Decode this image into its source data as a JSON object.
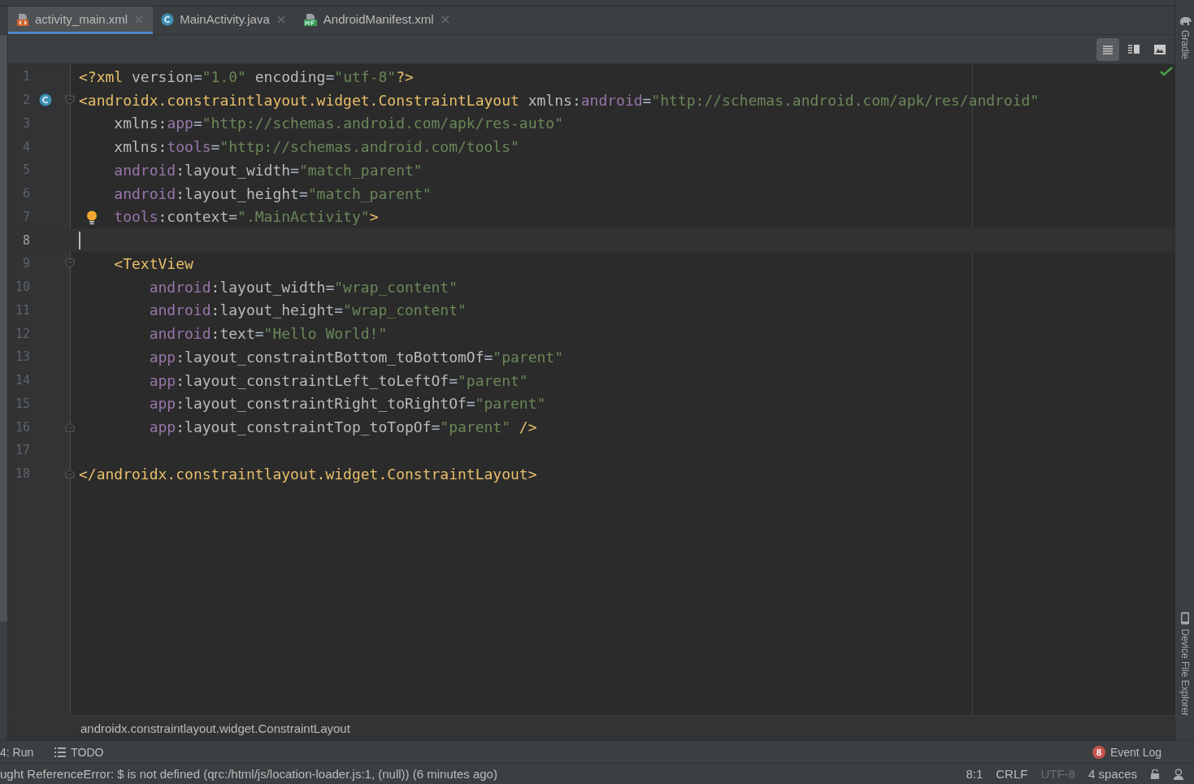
{
  "tabs": [
    {
      "label": "activity_main.xml",
      "kind": "xml",
      "selected": true
    },
    {
      "label": "MainActivity.java",
      "kind": "class",
      "selected": false
    },
    {
      "label": "AndroidManifest.xml",
      "kind": "manifest",
      "selected": false
    }
  ],
  "view_modes": [
    {
      "kind": "code",
      "selected": true
    },
    {
      "kind": "split",
      "selected": false
    },
    {
      "kind": "design",
      "selected": false
    }
  ],
  "editor": {
    "lines": [
      {
        "number": "1",
        "current": false,
        "tokens": [
          {
            "kind": "tag",
            "text": "<?xml"
          },
          {
            "kind": "attr",
            "text": " version"
          },
          {
            "kind": "plain",
            "text": "="
          },
          {
            "kind": "value",
            "text": "\"1.0\""
          },
          {
            "kind": "attr",
            "text": " encoding"
          },
          {
            "kind": "plain",
            "text": "="
          },
          {
            "kind": "value",
            "text": "\"utf-8\""
          },
          {
            "kind": "tag",
            "text": "?>"
          }
        ]
      },
      {
        "number": "2",
        "current": false,
        "marker": {
          "kind": "class"
        },
        "fold": {
          "kind": "start"
        },
        "tokens": [
          {
            "kind": "tag",
            "text": "<androidx.constraintlayout.widget.ConstraintLayout"
          },
          {
            "kind": "attr",
            "text": " xmlns:"
          },
          {
            "kind": "ns",
            "text": "android"
          },
          {
            "kind": "plain",
            "text": "="
          },
          {
            "kind": "value",
            "text": "\"http://schemas.android.com/apk/res/android\""
          }
        ]
      },
      {
        "number": "3",
        "current": false,
        "tokens": [
          {
            "kind": "attr",
            "text": "    xmlns:"
          },
          {
            "kind": "ns",
            "text": "app"
          },
          {
            "kind": "plain",
            "text": "="
          },
          {
            "kind": "value",
            "text": "\"http://schemas.android.com/apk/res-auto\""
          }
        ]
      },
      {
        "number": "4",
        "current": false,
        "tokens": [
          {
            "kind": "attr",
            "text": "    xmlns:"
          },
          {
            "kind": "ns",
            "text": "tools"
          },
          {
            "kind": "plain",
            "text": "="
          },
          {
            "kind": "value",
            "text": "\"http://schemas.android.com/tools\""
          }
        ]
      },
      {
        "number": "5",
        "current": false,
        "tokens": [
          {
            "kind": "ns",
            "text": "    android"
          },
          {
            "kind": "attr",
            "text": ":layout_width"
          },
          {
            "kind": "plain",
            "text": "="
          },
          {
            "kind": "value",
            "text": "\"match_parent\""
          }
        ]
      },
      {
        "number": "6",
        "current": false,
        "tokens": [
          {
            "kind": "ns",
            "text": "    android"
          },
          {
            "kind": "attr",
            "text": ":layout_height"
          },
          {
            "kind": "plain",
            "text": "="
          },
          {
            "kind": "value",
            "text": "\"match_parent\""
          }
        ]
      },
      {
        "number": "7",
        "current": false,
        "marker": {
          "kind": "bulb"
        },
        "tokens": [
          {
            "kind": "ns",
            "text": "    tools"
          },
          {
            "kind": "attr",
            "text": ":context"
          },
          {
            "kind": "plain",
            "text": "="
          },
          {
            "kind": "value",
            "text": "\".MainActivity\""
          },
          {
            "kind": "tag",
            "text": ">"
          }
        ]
      },
      {
        "number": "8",
        "current": true
      },
      {
        "number": "9",
        "current": false,
        "fold": {
          "kind": "start"
        },
        "tokens": [
          {
            "kind": "tag",
            "text": "    <TextView"
          }
        ]
      },
      {
        "number": "10",
        "current": false,
        "tokens": [
          {
            "kind": "ns",
            "text": "        android"
          },
          {
            "kind": "attr",
            "text": ":layout_width"
          },
          {
            "kind": "plain",
            "text": "="
          },
          {
            "kind": "value",
            "text": "\"wrap_content\""
          }
        ]
      },
      {
        "number": "11",
        "current": false,
        "tokens": [
          {
            "kind": "ns",
            "text": "        android"
          },
          {
            "kind": "attr",
            "text": ":layout_height"
          },
          {
            "kind": "plain",
            "text": "="
          },
          {
            "kind": "value",
            "text": "\"wrap_content\""
          }
        ]
      },
      {
        "number": "12",
        "current": false,
        "tokens": [
          {
            "kind": "ns",
            "text": "        android"
          },
          {
            "kind": "attr",
            "text": ":text"
          },
          {
            "kind": "plain",
            "text": "="
          },
          {
            "kind": "value",
            "text": "\"Hello World!\""
          }
        ]
      },
      {
        "number": "13",
        "current": false,
        "tokens": [
          {
            "kind": "ns",
            "text": "        app"
          },
          {
            "kind": "attr",
            "text": ":layout_constraintBottom_toBottomOf"
          },
          {
            "kind": "plain",
            "text": "="
          },
          {
            "kind": "value",
            "text": "\"parent\""
          }
        ]
      },
      {
        "number": "14",
        "current": false,
        "tokens": [
          {
            "kind": "ns",
            "text": "        app"
          },
          {
            "kind": "attr",
            "text": ":layout_constraintLeft_toLeftOf"
          },
          {
            "kind": "plain",
            "text": "="
          },
          {
            "kind": "value",
            "text": "\"parent\""
          }
        ]
      },
      {
        "number": "15",
        "current": false,
        "tokens": [
          {
            "kind": "ns",
            "text": "        app"
          },
          {
            "kind": "attr",
            "text": ":layout_constraintRight_toRightOf"
          },
          {
            "kind": "plain",
            "text": "="
          },
          {
            "kind": "value",
            "text": "\"parent\""
          }
        ]
      },
      {
        "number": "16",
        "current": false,
        "fold": {
          "kind": "end"
        },
        "tokens": [
          {
            "kind": "ns",
            "text": "        app"
          },
          {
            "kind": "attr",
            "text": ":layout_constraintTop_toTopOf"
          },
          {
            "kind": "plain",
            "text": "="
          },
          {
            "kind": "value",
            "text": "\"parent\""
          },
          {
            "kind": "tag",
            "text": " />"
          }
        ]
      },
      {
        "number": "17",
        "current": false
      },
      {
        "number": "18",
        "current": false,
        "fold": {
          "kind": "end"
        },
        "tokens": [
          {
            "kind": "tag",
            "text": "</androidx.constraintlayout.widget.ConstraintLayout>"
          }
        ]
      }
    ]
  },
  "breadcrumb": "androidx.constraintlayout.widget.ConstraintLayout",
  "side_tools": [
    {
      "label": "Gradle",
      "kind": "gradle"
    },
    {
      "label": "Device File Explorer",
      "kind": "device"
    }
  ],
  "tool_windows": [
    {
      "label": "4: Run",
      "kind": "plain"
    },
    {
      "label": "TODO",
      "kind": "list"
    }
  ],
  "event_log": {
    "label": "Event Log",
    "count": "8"
  },
  "status_bar": {
    "message": "ught ReferenceError: $ is not defined (qrc:/html/js/location-loader.js:1, (null)) (6 minutes ago)",
    "items": [
      {
        "kind": "text",
        "text": "8:1"
      },
      {
        "kind": "text",
        "text": "CRLF"
      },
      {
        "kind": "dim",
        "text": "UTF-8"
      },
      {
        "kind": "text",
        "text": "4 spaces"
      },
      {
        "kind": "lock"
      },
      {
        "kind": "inspector"
      }
    ]
  }
}
